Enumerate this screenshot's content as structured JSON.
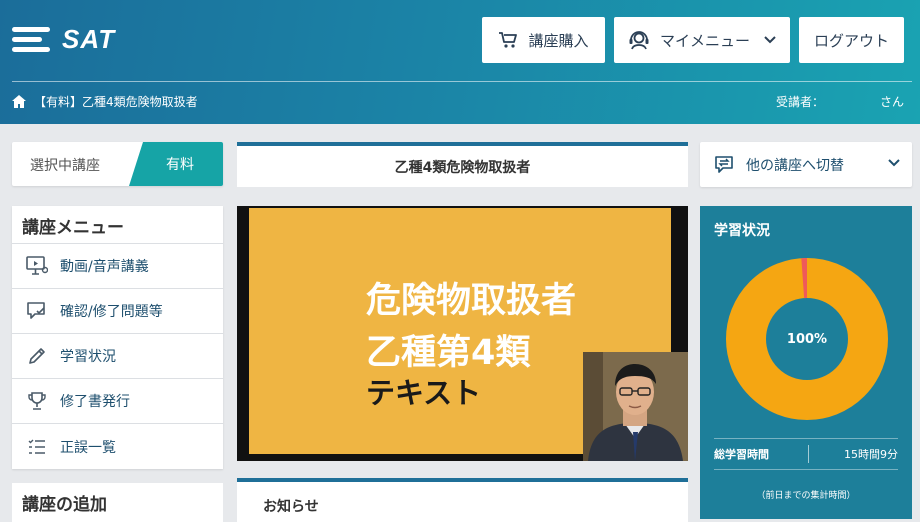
{
  "header": {
    "logo_text": "SAT",
    "purchase_label": "講座購入",
    "mymenu_label": "マイメニュー",
    "logout_label": "ログアウト",
    "breadcrumb": "【有料】乙種4類危険物取扱者",
    "student_label": "受講者：",
    "student_suffix": "さん"
  },
  "sidebar": {
    "selected_label": "選択中講座",
    "selected_tag": "有料",
    "menu_title": "講座メニュー",
    "items": [
      {
        "label": "動画/音声講義",
        "icon": "monitor-icon"
      },
      {
        "label": "確認/修了問題等",
        "icon": "chat-check-icon"
      },
      {
        "label": "学習状況",
        "icon": "pencil-icon"
      },
      {
        "label": "修了書発行",
        "icon": "trophy-icon"
      },
      {
        "label": "正誤一覧",
        "icon": "list-icon"
      }
    ],
    "add_title": "講座の追加"
  },
  "main": {
    "course_title": "乙種4類危険物取扱者",
    "video_line1": "危険物取扱者",
    "video_line2": "乙種第4類",
    "video_line3": "テキスト",
    "notice_title": "お知らせ"
  },
  "right": {
    "switch_label": "他の講座へ切替",
    "study_title": "学習状況",
    "progress_percent": 100,
    "progress_label": "100%",
    "total_time_label": "総学習時間",
    "total_time_value": "15時間9分",
    "note": "（前日までの集計時間）",
    "colors": {
      "ring": "#f5a612",
      "accent": "#ef5a5a"
    }
  }
}
